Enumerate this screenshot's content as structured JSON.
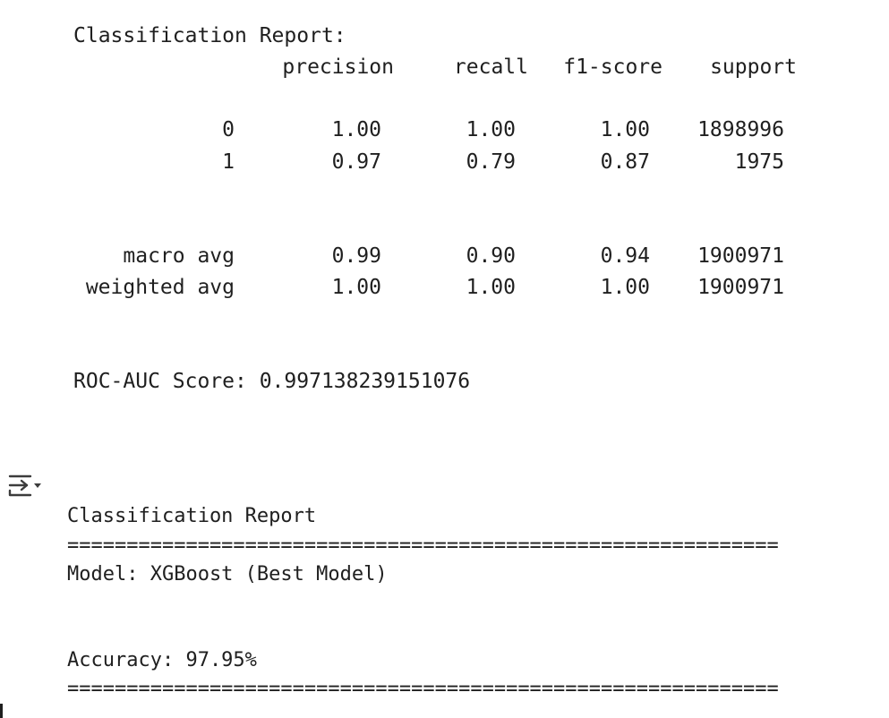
{
  "report1": {
    "title": "Classification Report:",
    "headers": [
      "precision",
      "recall",
      "f1-score",
      "support"
    ],
    "rows": [
      {
        "label": "0",
        "precision": "1.00",
        "recall": "1.00",
        "f1": "1.00",
        "support": "1898996"
      },
      {
        "label": "1",
        "precision": "0.97",
        "recall": "0.79",
        "f1": "0.87",
        "support": "1975"
      },
      {
        "label": "macro avg",
        "precision": "0.99",
        "recall": "0.90",
        "f1": "0.94",
        "support": "1900971"
      },
      {
        "label": "weighted avg",
        "precision": "1.00",
        "recall": "1.00",
        "f1": "1.00",
        "support": "1900971"
      }
    ],
    "roc_auc": "ROC-AUC Score: 0.997138239151076"
  },
  "output_toggle": {
    "icon": "output-toggle-icon"
  },
  "report2": {
    "title": "Classification Report",
    "separator": "============================================================",
    "model": "Model: XGBoost (Best Model)",
    "accuracy": "Accuracy: 97.95%"
  }
}
